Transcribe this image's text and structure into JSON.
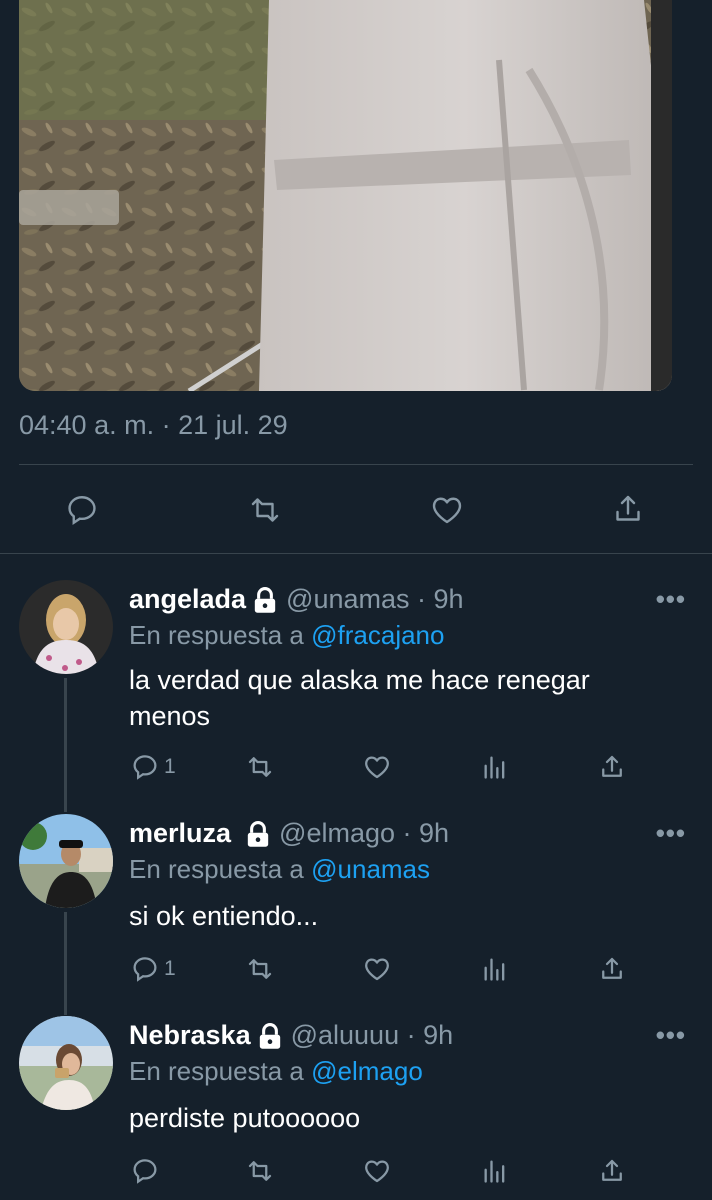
{
  "tweet": {
    "timestamp": "04:40 a. m. · 21 jul. 29"
  },
  "replies": [
    {
      "name": "angelada",
      "handle": "@unamas",
      "time": "9h",
      "in_reply_prefix": "En respuesta a",
      "in_reply_to": "@fracajano",
      "text": "la verdad que alaska me hace renegar menos",
      "reply_count": "1",
      "more": "•••"
    },
    {
      "name": "merluza",
      "handle": "@elmago",
      "time": "9h",
      "in_reply_prefix": "En respuesta a",
      "in_reply_to": "@unamas",
      "text": "si ok entiendo...",
      "reply_count": "1",
      "more": "•••"
    },
    {
      "name": "Nebraska",
      "handle": "@aluuuu",
      "time": "9h",
      "in_reply_prefix": "En respuesta a",
      "in_reply_to": "@elmago",
      "text": "perdiste putoooooo",
      "reply_count": "",
      "more": "•••"
    }
  ],
  "colors": {
    "background": "#15202b",
    "secondary_text": "#8899a6",
    "mention": "#1da1f2",
    "divider": "#38444d"
  },
  "icons": [
    "reply-icon",
    "retweet-icon",
    "like-icon",
    "analytics-icon",
    "share-icon",
    "lock-icon",
    "more-icon"
  ]
}
